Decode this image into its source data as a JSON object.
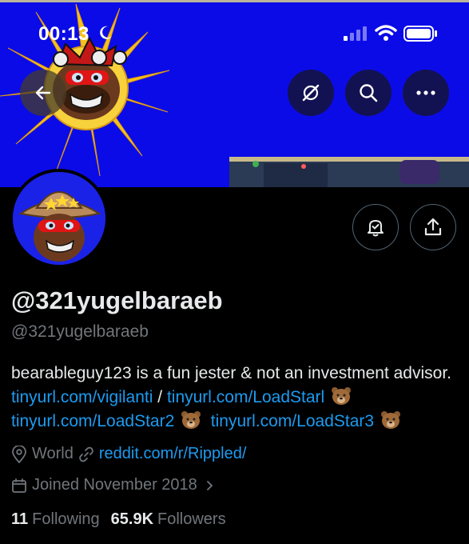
{
  "status_bar": {
    "time": "00:13"
  },
  "profile": {
    "display_name": "@321yugelbaraeb",
    "handle": "@321yugelbaraeb",
    "bio_text": "bearableguy123 is a fun jester & not an investment advisor.",
    "bio_links": [
      "tinyurl.com/vigilanti",
      "tinyurl.com/LoadStarl",
      "tinyurl.com/LoadStar2",
      "tinyurl.com/LoadStar3"
    ],
    "bio_separator": "/",
    "location": "World",
    "website": "reddit.com/r/Rippled/",
    "joined": "Joined November 2018",
    "following_count": "11",
    "following_label": "Following",
    "followers_count": "65.9K",
    "followers_label": "Followers"
  },
  "icons": [
    "back-arrow-icon",
    "grok-icon",
    "search-icon",
    "more-icon",
    "notification-bell-icon",
    "share-icon",
    "location-pin-icon",
    "link-icon",
    "calendar-icon",
    "chevron-right-icon",
    "bear-emoji-icon"
  ],
  "colors": {
    "link": "#1d9bf0",
    "banner": "#0a0ae6",
    "muted": "#71767b",
    "text": "#e7e9ea"
  }
}
